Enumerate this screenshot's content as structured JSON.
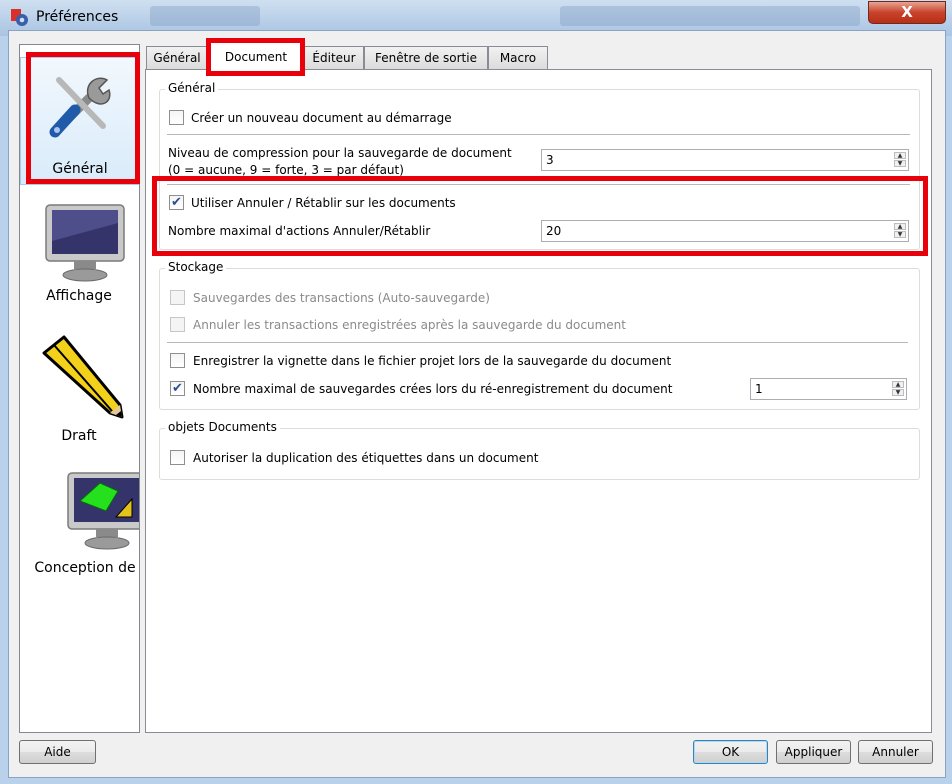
{
  "window": {
    "title": "Préférences",
    "close_label": "X"
  },
  "categories": [
    {
      "label": "Général",
      "icon": "tools-icon",
      "selected": true
    },
    {
      "label": "Affichage",
      "icon": "monitor-icon"
    },
    {
      "label": "Draft",
      "icon": "pencil-icon"
    },
    {
      "label": "Conception de",
      "icon": "drawing-monitor-icon"
    }
  ],
  "tabs": [
    "Général",
    "Document",
    "Éditeur",
    "Fenêtre de sortie",
    "Macro"
  ],
  "active_tab": "Document",
  "general_group": {
    "title": "Général",
    "new_doc_label": "Créer un nouveau document au démarrage",
    "new_doc_checked": false,
    "compression_label_1": "Niveau de compression pour la sauvegarde de document",
    "compression_label_2": "(0 = aucune, 9 = forte, 3 = par défaut)",
    "compression_value": "3",
    "undo_label": "Utiliser Annuler / Rétablir sur les documents",
    "undo_checked": true,
    "max_undo_label": "Nombre maximal d'actions Annuler/Rétablir",
    "max_undo_value": "20"
  },
  "storage_group": {
    "title": "Stockage",
    "autosave_label": "Sauvegardes des transactions (Auto-sauvegarde)",
    "cancel_tx_label": "Annuler les transactions enregistrées après la sauvegarde du document",
    "thumbnail_label": "Enregistrer la vignette dans le fichier projet lors de la sauvegarde du document",
    "max_backups_label": "Nombre maximal de sauvegardes crées lors du ré-enregistrement du document",
    "max_backups_checked": true,
    "max_backups_value": "1"
  },
  "objects_group": {
    "title": "objets Documents",
    "duplicate_labels_label": "Autoriser la duplication des étiquettes dans un document"
  },
  "buttons": {
    "help": "Aide",
    "ok": "OK",
    "apply": "Appliquer",
    "cancel": "Annuler"
  },
  "colors": {
    "highlight": "#e8000b",
    "check": "#2a4f8f"
  }
}
